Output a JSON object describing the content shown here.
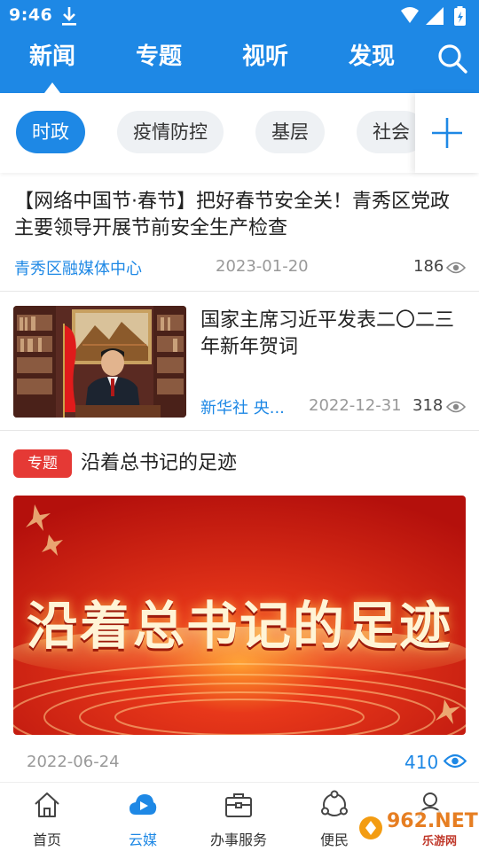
{
  "status": {
    "time": "9:46"
  },
  "nav": {
    "tabs": [
      "新闻",
      "专题",
      "视听",
      "发现"
    ],
    "active_index": 0
  },
  "chips": [
    "时政",
    "疫情防控",
    "基层",
    "社会"
  ],
  "news": [
    {
      "title": "【网络中国节·春节】把好春节安全关！青秀区党政主要领导开展节前安全生产检查",
      "source": "青秀区融媒体中心",
      "date": "2023-01-20",
      "views": "186"
    },
    {
      "title": "国家主席习近平发表二〇二三年新年贺词",
      "source": "新华社 央...",
      "date": "2022-12-31",
      "views": "318"
    }
  ],
  "special": {
    "tag": "专题",
    "title": "沿着总书记的足迹",
    "banner_text": "沿着总书记的足迹",
    "date": "2022-06-24",
    "views": "410"
  },
  "bottom_nav": [
    {
      "label": "首页",
      "icon": "home-icon"
    },
    {
      "label": "云媒",
      "icon": "cloud-icon",
      "active": true
    },
    {
      "label": "办事服务",
      "icon": "briefcase-icon"
    },
    {
      "label": "便民",
      "icon": "share-circle-icon"
    },
    {
      "label": "",
      "icon": "user-icon"
    }
  ],
  "watermark": {
    "brand": "962.NET",
    "sub": "乐游网"
  },
  "colors": {
    "primary": "#1e88e5",
    "tag_red": "#e53935",
    "banner_red": "#d81e12"
  }
}
